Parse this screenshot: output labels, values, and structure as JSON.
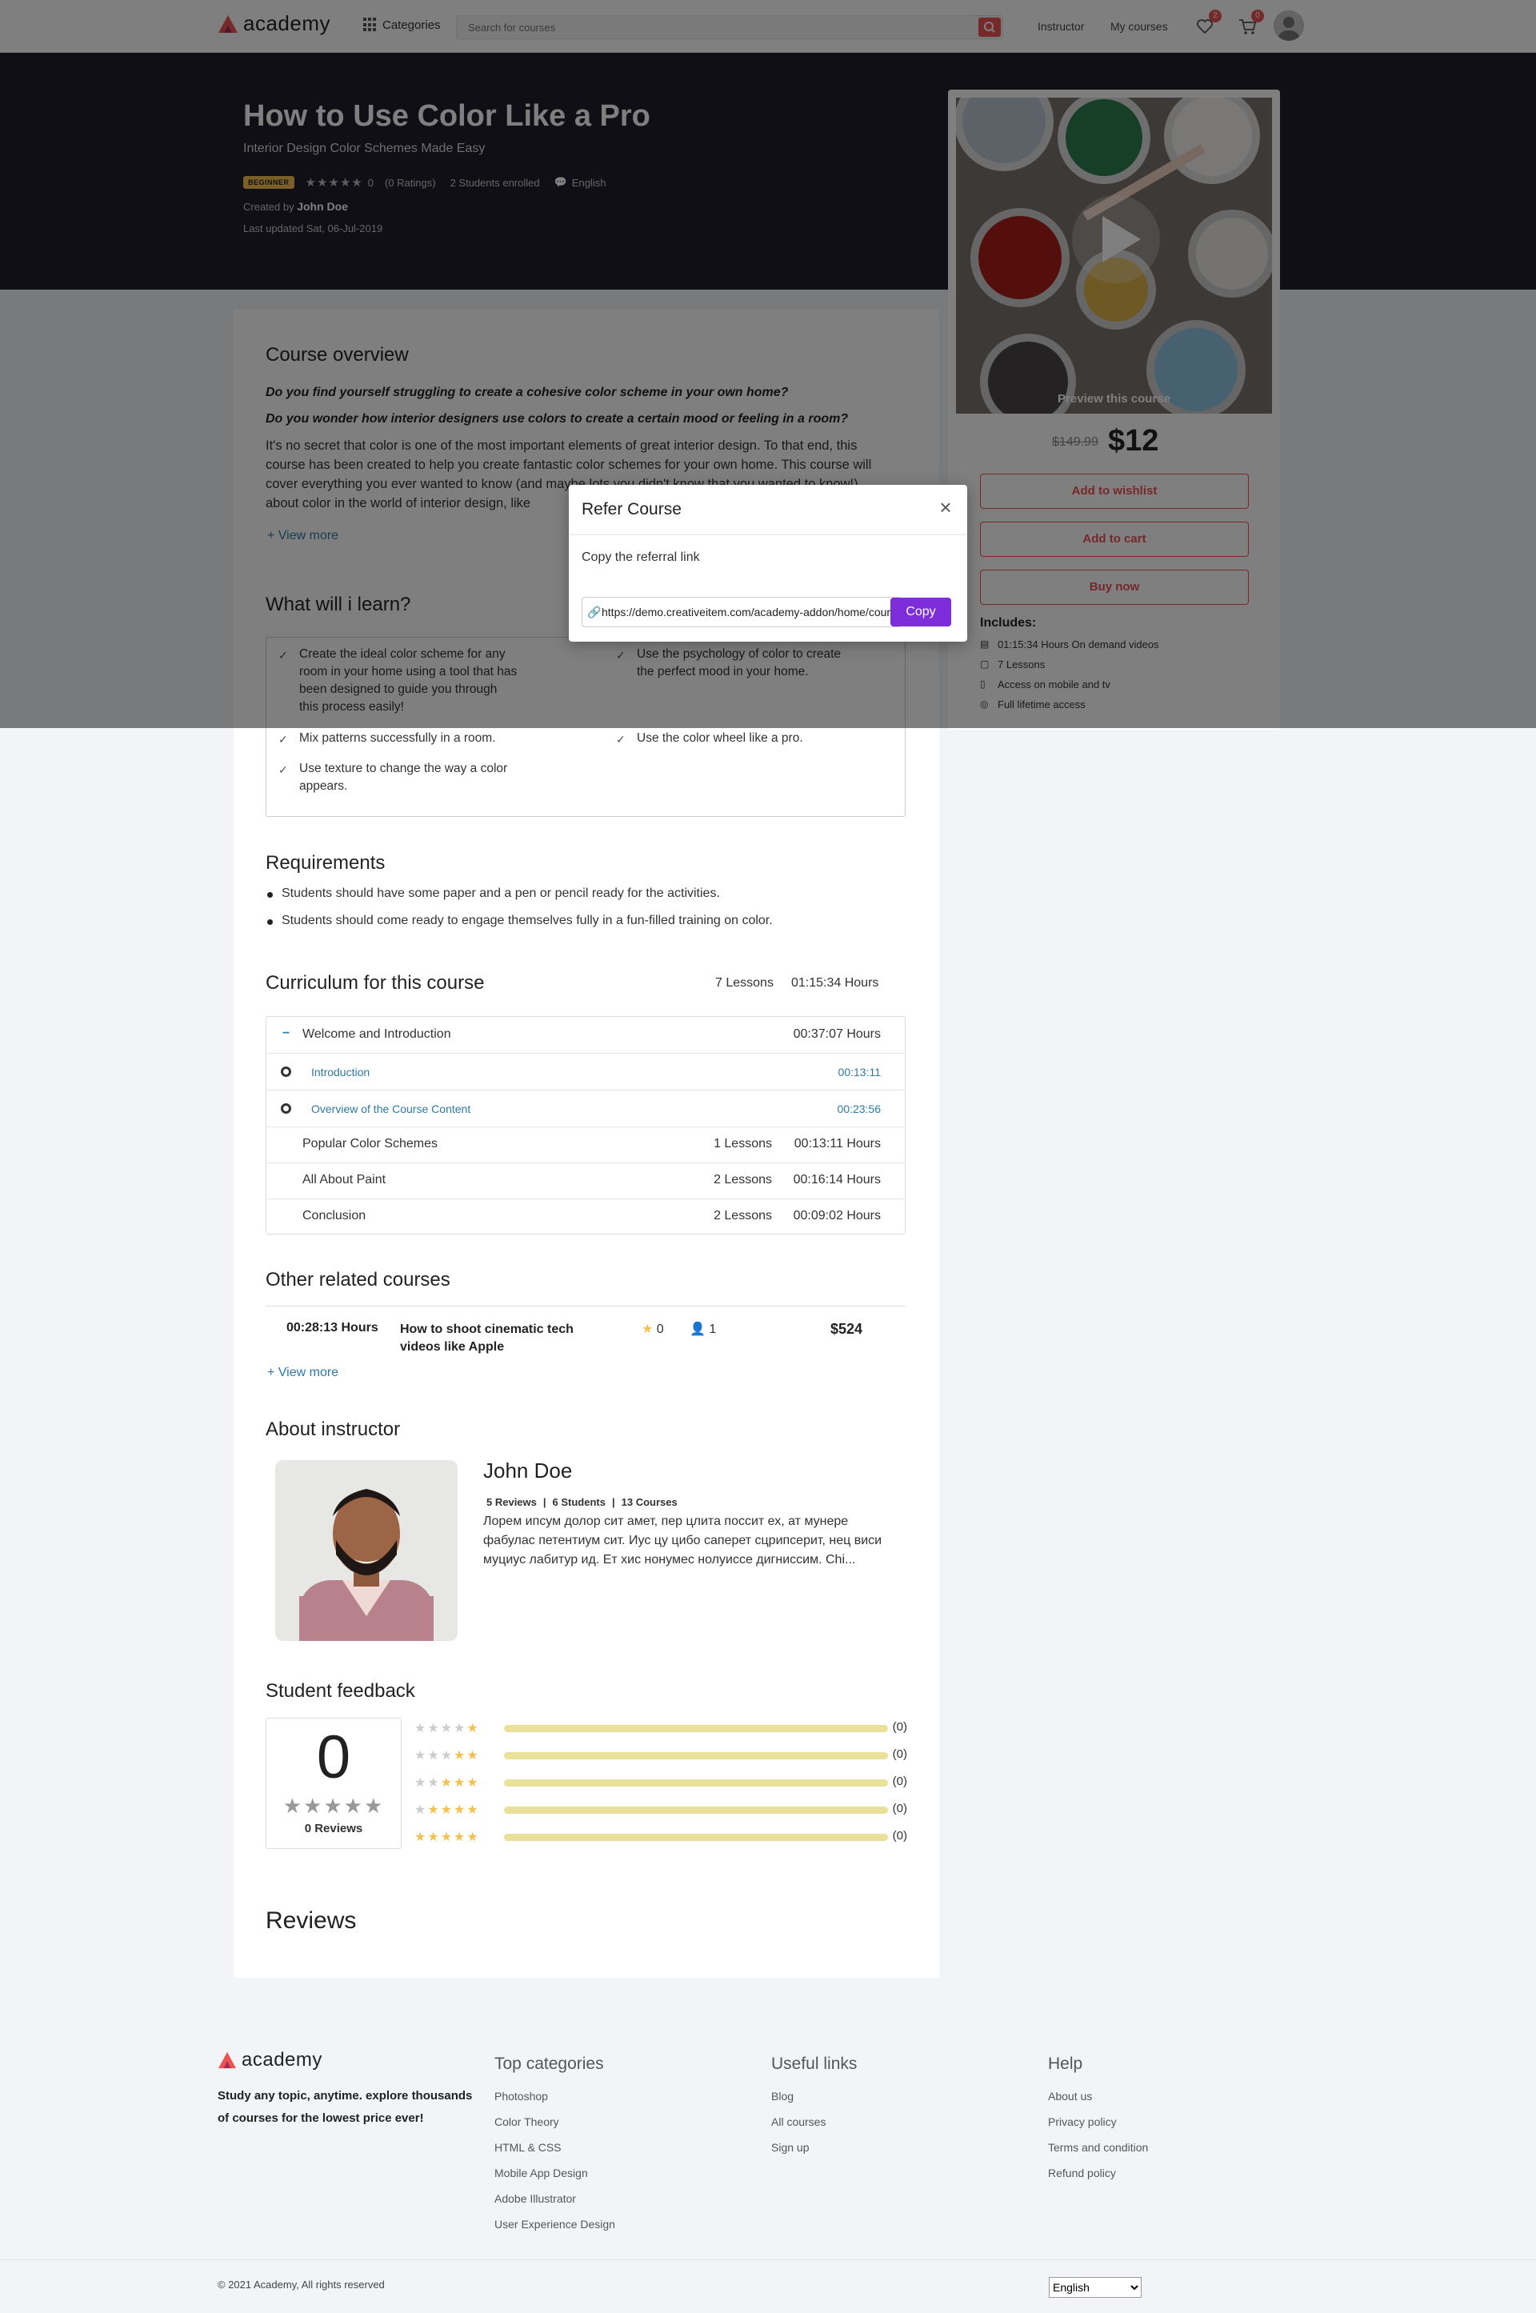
{
  "header": {
    "logo_text": "academy",
    "categories_label": "Categories",
    "search_placeholder": "Search for courses",
    "nav_instructor": "Instructor",
    "nav_my_courses": "My courses",
    "wishlist_count": "2",
    "cart_count": "0"
  },
  "hero": {
    "title": "How to Use Color Like a Pro",
    "subtitle": "Interior Design Color Schemes Made Easy",
    "level": "BEGINNER",
    "rating_value": "0",
    "ratings_text": "(0 Ratings)",
    "enrolled_text": "2 Students enrolled",
    "language": "English",
    "created_by_label": "Created by",
    "author": "John Doe",
    "last_updated": "Last updated Sat, 06-Jul-2019"
  },
  "overview": {
    "heading": "Course overview",
    "q1": "Do you find yourself struggling to create a cohesive color scheme in your own home?",
    "q2": "Do you wonder how interior designers use colors to create a certain mood or feeling in a room?",
    "body": "It's no secret that color is one of the most important elements of great interior design.  To that end, this course has been created to help you create fantastic color schemes for your own home.  This course will cover everything you ever wanted to know (and maybe lots you didn't know that you wanted to know!) about color in the world of interior design, like",
    "view_more": "+ View more"
  },
  "learn": {
    "heading": "What will i learn?",
    "items": [
      "Create the ideal color scheme for any room in your home using a tool that has been designed to guide you through this process easily!",
      "Use the psychology of color to create the perfect mood in your home.",
      "Mix patterns successfully in a room.",
      "Use the color wheel like a pro.",
      "Use texture to change the way a color appears."
    ]
  },
  "requirements": {
    "heading": "Requirements",
    "items": [
      "Students should have some paper and a pen or pencil ready for the activities.",
      "Students should come ready to engage themselves fully in a fun-filled training on color."
    ]
  },
  "curriculum": {
    "heading": "Curriculum for this course",
    "total_lessons": "7 Lessons",
    "total_hours": "01:15:34 Hours",
    "open_section": {
      "toggle": "−",
      "title": "Welcome and Introduction",
      "duration": "00:37:07 Hours"
    },
    "lessons": [
      {
        "title": "Introduction",
        "duration": "00:13:11"
      },
      {
        "title": "Overview of the Course Content",
        "duration": "00:23:56"
      }
    ],
    "sections": [
      {
        "title": "Popular Color Schemes",
        "lessons": "1 Lessons",
        "duration": "00:13:11 Hours"
      },
      {
        "title": "All About Paint",
        "lessons": "2 Lessons",
        "duration": "00:16:14 Hours"
      },
      {
        "title": "Conclusion",
        "lessons": "2 Lessons",
        "duration": "00:09:02 Hours"
      }
    ]
  },
  "related": {
    "heading": "Other related courses",
    "course": {
      "duration": "00:28:13 Hours",
      "title": "How to shoot cinematic tech videos like Apple",
      "rating": "0",
      "students": "1",
      "price": "$524"
    },
    "view_more": "+ View more"
  },
  "instructor": {
    "heading": "About instructor",
    "name": "John Doe",
    "reviews": "5 Reviews",
    "students": "6 Students",
    "courses": "13 Courses",
    "bio": "Лорем ипсум долор сит амет, пер цлита поссит ех, ат мунере фабулас петентиум сит. Иус цу цибо саперет сцрипсерит, нец виси муциус лабитур ид. Ет хис нонумес нолуиссе дигниссим. Chi..."
  },
  "feedback": {
    "heading": "Student feedback",
    "average": "0",
    "reviews_label": "0 Reviews",
    "rows": [
      {
        "stars": 1,
        "count": "(0)"
      },
      {
        "stars": 2,
        "count": "(0)"
      },
      {
        "stars": 3,
        "count": "(0)"
      },
      {
        "stars": 4,
        "count": "(0)"
      },
      {
        "stars": 5,
        "count": "(0)"
      }
    ]
  },
  "reviews": {
    "heading": "Reviews"
  },
  "sidebar": {
    "preview_label": "Preview this course",
    "price_old": "$149.99",
    "price_new": "$12",
    "wishlist_btn": "Add to wishlist",
    "cart_btn": "Add to cart",
    "buy_btn": "Buy now",
    "includes_heading": "Includes:",
    "includes": [
      "01:15:34 Hours On demand videos",
      "7 Lessons",
      "Access on mobile and tv",
      "Full lifetime access"
    ]
  },
  "modal": {
    "title": "Refer Course",
    "label": "Copy the referral link",
    "link": "https://demo.creativeitem.com/academy-addon/home/course/how-to-use-color-like-a-pro",
    "copy_btn": "Copy"
  },
  "footer": {
    "logo_text": "academy",
    "tagline": "Study any topic, anytime. explore thousands of courses for the lowest price ever!",
    "col1_heading": "Top categories",
    "col1_links": [
      "Photoshop",
      "Color Theory",
      "HTML & CSS",
      "Mobile App Design",
      "Adobe Illustrator",
      "User Experience Design"
    ],
    "col2_heading": "Useful links",
    "col2_links": [
      "Blog",
      "All courses",
      "Sign up"
    ],
    "col3_heading": "Help",
    "col3_links": [
      "About us",
      "Privacy policy",
      "Terms and condition",
      "Refund policy"
    ],
    "copyright": "© 2021 Academy, All rights reserved",
    "language_selected": "English"
  },
  "colors": {
    "brand_red": "#ec5252",
    "hero_bg": "#1e1f2a",
    "copy_purple": "#7e2ddb",
    "star_yellow": "#f4c150",
    "link_blue": "#2d7aa5"
  }
}
